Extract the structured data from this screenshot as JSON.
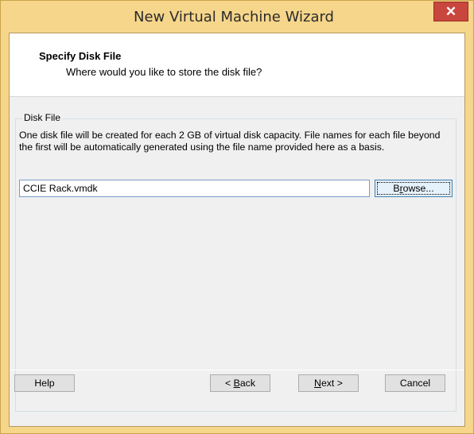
{
  "window": {
    "title": "New Virtual Machine Wizard",
    "close_glyph": "✕",
    "colors": {
      "frame": "#f6d68b",
      "close": "#c8463d",
      "client": "#f0f0f0"
    }
  },
  "header": {
    "title": "Specify Disk File",
    "subtitle": "Where would you like to store the disk file?"
  },
  "disk_file": {
    "group_label": "Disk File",
    "description": "One disk file will be created for each 2 GB of virtual disk capacity. File names for each file beyond the first will be automatically generated using the file name provided here as a basis.",
    "path_value": "CCIE Rack.vmdk",
    "browse_prefix": "B",
    "browse_mnemonic": "r",
    "browse_suffix": "owse..."
  },
  "buttons": {
    "help": "Help",
    "back_prefix": "< ",
    "back_mnemonic": "B",
    "back_suffix": "ack",
    "next_mnemonic": "N",
    "next_suffix": "ext >",
    "cancel": "Cancel"
  }
}
